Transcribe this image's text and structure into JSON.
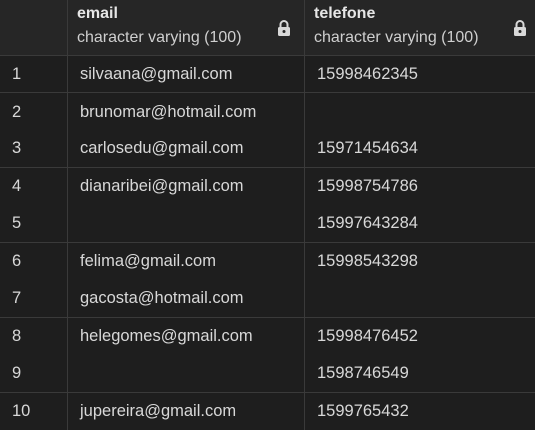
{
  "columns": {
    "email": {
      "name": "email",
      "type": "character varying (100)"
    },
    "telefone": {
      "name": "telefone",
      "type": "character varying (100)"
    }
  },
  "rows": [
    {
      "num": "1",
      "email": "silvaana@gmail.com",
      "telefone": "15998462345"
    },
    {
      "num": "2",
      "email": "brunomar@hotmail.com",
      "telefone": ""
    },
    {
      "num": "3",
      "email": "carlosedu@gmail.com",
      "telefone": "15971454634"
    },
    {
      "num": "4",
      "email": "dianaribei@gmail.com",
      "telefone": "15998754786"
    },
    {
      "num": "5",
      "email": "",
      "telefone": "15997643284"
    },
    {
      "num": "6",
      "email": "felima@gmail.com",
      "telefone": "15998543298"
    },
    {
      "num": "7",
      "email": "gacosta@hotmail.com",
      "telefone": ""
    },
    {
      "num": "8",
      "email": "helegomes@gmail.com",
      "telefone": "15998476452"
    },
    {
      "num": "9",
      "email": "",
      "telefone": "1598746549"
    },
    {
      "num": "10",
      "email": "jupereira@gmail.com",
      "telefone": "1599765432"
    }
  ],
  "icons": {
    "column_lock": "lock-icon"
  }
}
